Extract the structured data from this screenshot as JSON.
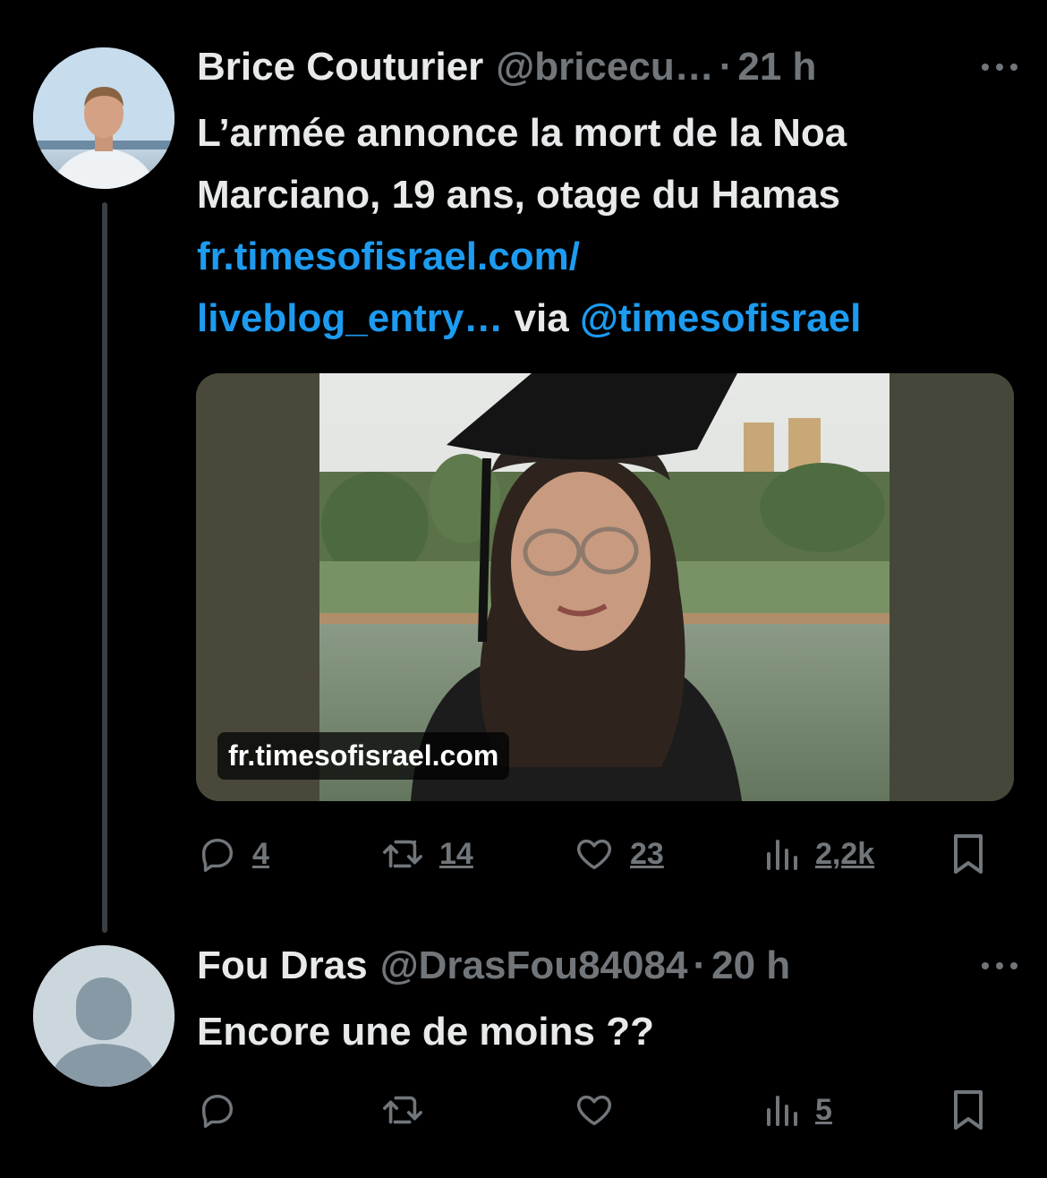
{
  "tweet": {
    "author_name": "Brice Couturier",
    "handle": "@bricecu…",
    "separator": "·",
    "time": "21 h",
    "text_line1": "L’armée annonce la mort de la Noa",
    "text_line2": "Marciano, 19 ans, otage du Hamas",
    "link_line1": "fr.timesofisrael.com/",
    "link_line2": "liveblog_entry…",
    "via_text": "via",
    "via_handle": "@timesofisrael",
    "card_domain": "fr.timesofisrael.com",
    "stats": {
      "replies": "4",
      "reposts": "14",
      "likes": "23",
      "views": "2,2k"
    }
  },
  "reply": {
    "author_name": "Fou Dras",
    "handle": "@DrasFou84084",
    "separator": "·",
    "time": "20 h",
    "text": "Encore une de moins ??",
    "stats": {
      "views": "5"
    }
  },
  "icons": [
    "more-icon",
    "reply-icon",
    "repost-icon",
    "like-icon",
    "views-icon",
    "bookmark-icon"
  ],
  "colors": {
    "background": "#000000",
    "text": "#e7e9ea",
    "muted": "#71767b",
    "link": "#1d9bf0"
  }
}
